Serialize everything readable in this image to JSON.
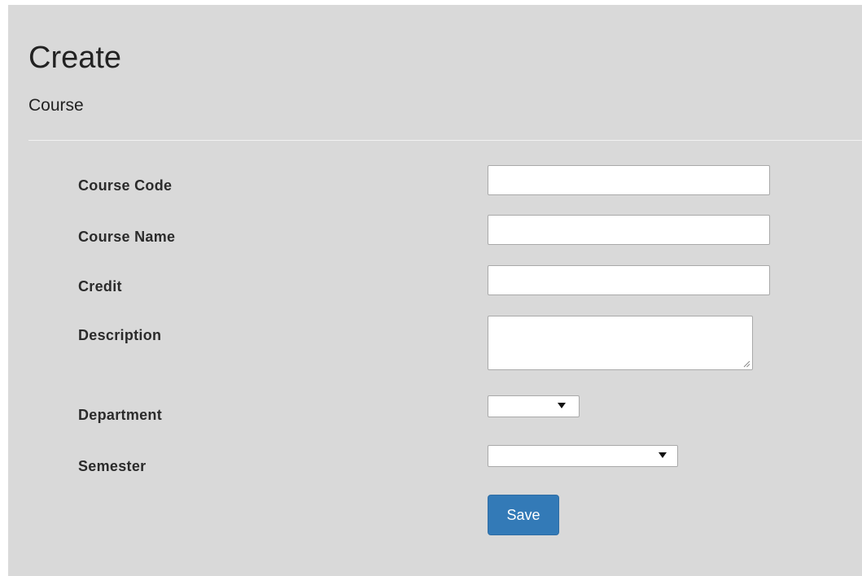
{
  "page": {
    "title": "Create",
    "subtitle": "Course"
  },
  "form": {
    "fields": [
      {
        "label": "Course Code",
        "type": "text",
        "value": ""
      },
      {
        "label": "Course Name",
        "type": "text",
        "value": ""
      },
      {
        "label": "Credit",
        "type": "text",
        "value": ""
      },
      {
        "label": "Description",
        "type": "textarea",
        "value": ""
      },
      {
        "label": "Department",
        "type": "select",
        "selected": ""
      },
      {
        "label": "Semester",
        "type": "select",
        "selected": ""
      }
    ],
    "save_label": "Save"
  },
  "colors": {
    "background": "#d9d9d9",
    "primary_button": "#337ab7"
  }
}
